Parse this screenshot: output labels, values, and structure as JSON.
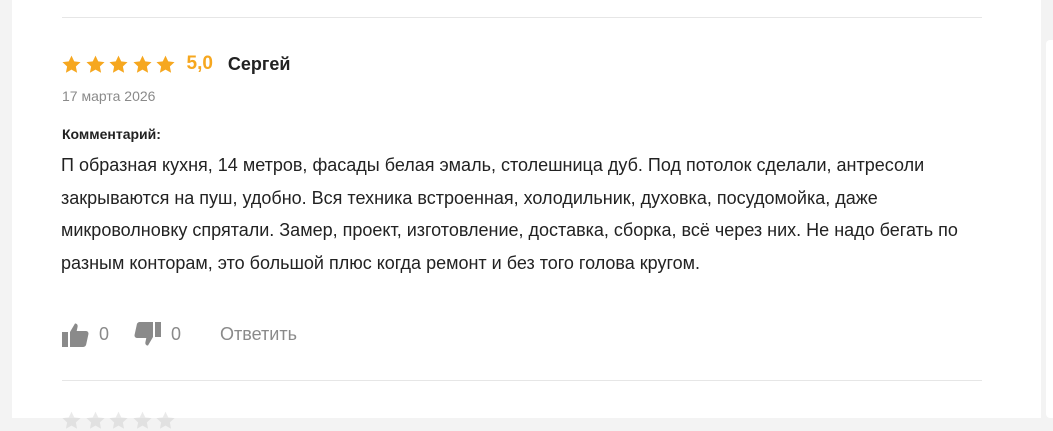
{
  "colors": {
    "star": "#f6a71f",
    "muted": "#8a8a8a",
    "text": "#222222",
    "divider": "#e6e6e6"
  },
  "review": {
    "stars_filled": 5,
    "stars_total": 5,
    "rating": "5,0",
    "author": "Сергей",
    "date": "17 марта 2026",
    "comment_label": "Комментарий:",
    "comment_text": "П образная кухня, 14 метров, фасады белая эмаль, столешница дуб. Под потолок сделали, антресоли закрываются на пуш, удобно. Вся техника встроенная, холодильник, духовка, посудомойка, даже микроволновку спрятали. Замер, проект, изготовление, доставка, сборка, всё через них. Не надо бегать по разным конторам, это большой плюс когда ремонт и без того голова кругом."
  },
  "actions": {
    "like_icon": "thumbs-up-icon",
    "like_count": "0",
    "dislike_icon": "thumbs-down-icon",
    "dislike_count": "0",
    "reply_label": "Ответить"
  }
}
